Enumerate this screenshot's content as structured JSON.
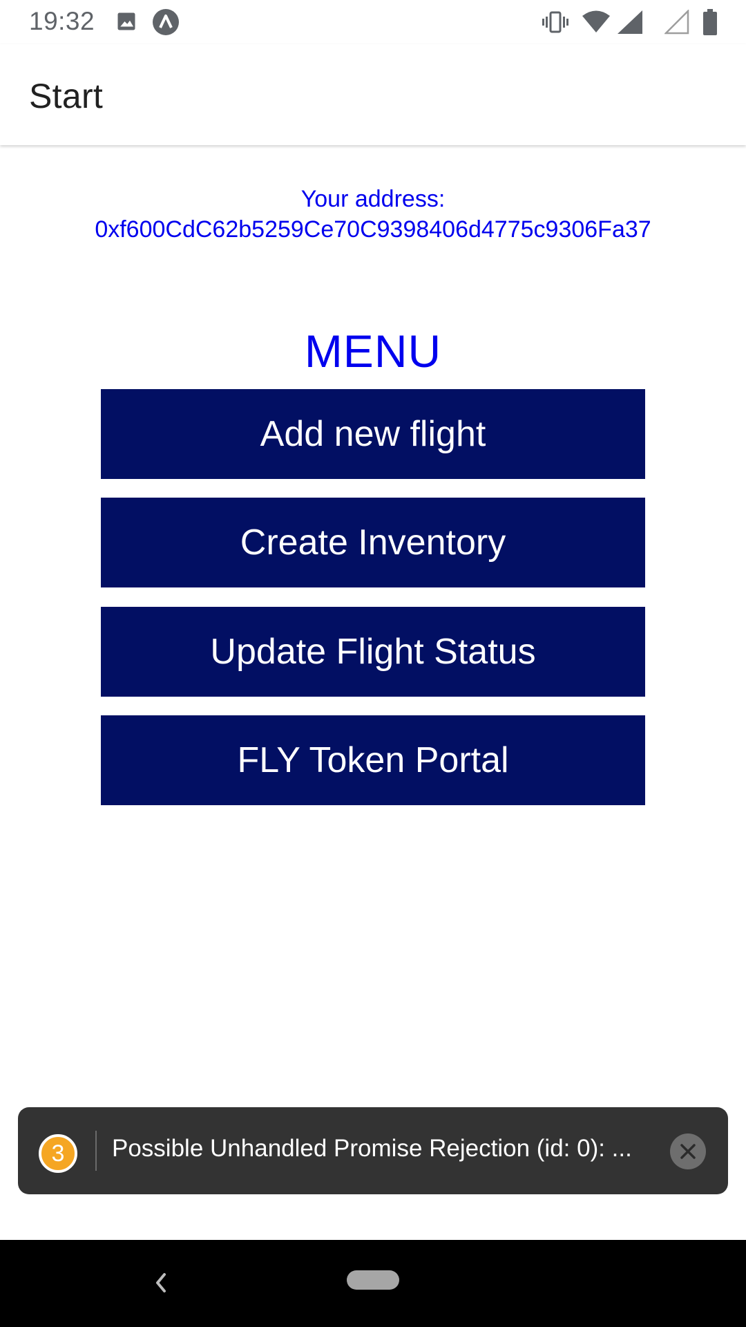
{
  "status_bar": {
    "time": "19:32",
    "icons": [
      "image-icon",
      "app-notification-icon",
      "vibrate-icon",
      "wifi-icon",
      "signal-icon",
      "signal-empty-icon",
      "battery-icon"
    ]
  },
  "app_bar": {
    "title": "Start"
  },
  "address": {
    "label": "Your address:",
    "value": "0xf600CdC62b5259Ce70C9398406d4775c9306Fa37"
  },
  "menu": {
    "title": "MENU",
    "buttons": [
      {
        "label": "Add new flight"
      },
      {
        "label": "Create Inventory"
      },
      {
        "label": "Update Flight Status"
      },
      {
        "label": "FLY Token Portal"
      }
    ]
  },
  "toast": {
    "count": "3",
    "message": "Possible Unhandled Promise Rejection (id: 0): ..."
  },
  "colors": {
    "link_blue": "#0000ee",
    "button_navy": "#020f63",
    "toast_bg": "#333333",
    "badge_orange": "#f5a623"
  }
}
